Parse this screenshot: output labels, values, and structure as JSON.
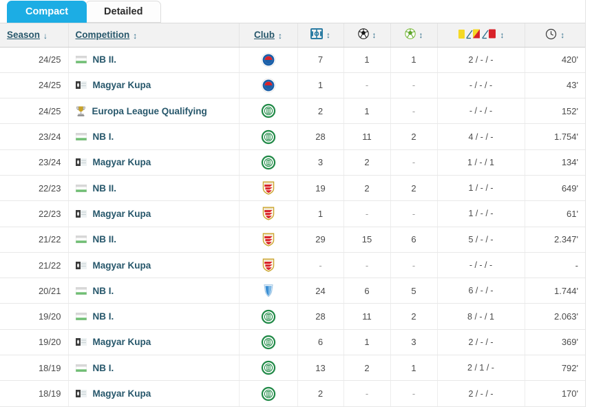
{
  "tabs": [
    {
      "label": "Compact",
      "active": true,
      "name": "tab-compact"
    },
    {
      "label": "Detailed",
      "active": false,
      "name": "tab-detailed"
    }
  ],
  "colors": {
    "tab_active_bg": "#1cade4",
    "header_bg": "#f2f2f2",
    "link": "#27576b",
    "number": "#2b7ca3",
    "yellow_card": "#f5d926",
    "red_card": "#d8232a"
  },
  "table": {
    "columns": [
      {
        "key": "season",
        "label": "Season",
        "icon": "",
        "sort": "desc",
        "sortable": true
      },
      {
        "key": "competition",
        "label": "Competition",
        "icon": "",
        "sort": "sortable",
        "sortable": true
      },
      {
        "key": "club",
        "label": "Club",
        "icon": "",
        "sort": "sortable",
        "sortable": true
      },
      {
        "key": "appearances",
        "label": "",
        "icon": "pitch-icon",
        "sort": "sortable",
        "sortable": true
      },
      {
        "key": "goals",
        "label": "",
        "icon": "football-icon",
        "sort": "sortable",
        "sortable": true
      },
      {
        "key": "assists",
        "label": "",
        "icon": "assist-ball-icon",
        "sort": "sortable",
        "sortable": true
      },
      {
        "key": "cards",
        "label": "",
        "icon": "cards-icon",
        "sort": "sortable",
        "sortable": true
      },
      {
        "key": "minutes",
        "label": "",
        "icon": "clock-icon",
        "sort": "sortable",
        "sortable": true
      }
    ],
    "rows": [
      {
        "season": "24/25",
        "competition": "NB II.",
        "comp_icon": "hungary-flag-icon",
        "club_badge": "club-blue-red-circle",
        "appearances": "7",
        "goals": "1",
        "assists": "1",
        "cards": "2 / - / -",
        "minutes": "420'"
      },
      {
        "season": "24/25",
        "competition": "Magyar Kupa",
        "comp_icon": "cup-flag-icon",
        "club_badge": "club-blue-red-circle",
        "appearances": "1",
        "goals": "-",
        "assists": "-",
        "cards": "- / - / -",
        "minutes": "43'"
      },
      {
        "season": "24/25",
        "competition": "Europa League Qualifying",
        "comp_icon": "trophy-icon",
        "club_badge": "club-green-circle",
        "appearances": "2",
        "goals": "1",
        "assists": "-",
        "cards": "- / - / -",
        "minutes": "152'"
      },
      {
        "season": "23/24",
        "competition": "NB I.",
        "comp_icon": "hungary-flag-icon",
        "club_badge": "club-green-circle",
        "appearances": "28",
        "goals": "11",
        "assists": "2",
        "cards": "4 / - / -",
        "minutes": "1.754'"
      },
      {
        "season": "23/24",
        "competition": "Magyar Kupa",
        "comp_icon": "cup-flag-icon",
        "club_badge": "club-green-circle",
        "appearances": "3",
        "goals": "2",
        "assists": "-",
        "cards": "1 / - / 1",
        "minutes": "134'"
      },
      {
        "season": "22/23",
        "competition": "NB II.",
        "comp_icon": "hungary-flag-icon",
        "club_badge": "club-red-white-shield",
        "appearances": "19",
        "goals": "2",
        "assists": "2",
        "cards": "1 / - / -",
        "minutes": "649'"
      },
      {
        "season": "22/23",
        "competition": "Magyar Kupa",
        "comp_icon": "cup-flag-icon",
        "club_badge": "club-red-white-shield",
        "appearances": "1",
        "goals": "-",
        "assists": "-",
        "cards": "1 / - / -",
        "minutes": "61'"
      },
      {
        "season": "21/22",
        "competition": "NB II.",
        "comp_icon": "hungary-flag-icon",
        "club_badge": "club-red-white-shield",
        "appearances": "29",
        "goals": "15",
        "assists": "6",
        "cards": "5 / - / -",
        "minutes": "2.347'"
      },
      {
        "season": "21/22",
        "competition": "Magyar Kupa",
        "comp_icon": "cup-flag-icon",
        "club_badge": "club-red-white-shield",
        "appearances": "-",
        "goals": "-",
        "assists": "-",
        "cards": "- / - / -",
        "minutes": "-"
      },
      {
        "season": "20/21",
        "competition": "NB I.",
        "comp_icon": "hungary-flag-icon",
        "club_badge": "club-blue-shield",
        "appearances": "24",
        "goals": "6",
        "assists": "5",
        "cards": "6 / - / -",
        "minutes": "1.744'"
      },
      {
        "season": "19/20",
        "competition": "NB I.",
        "comp_icon": "hungary-flag-icon",
        "club_badge": "club-green-circle",
        "appearances": "28",
        "goals": "11",
        "assists": "2",
        "cards": "8 / - / 1",
        "minutes": "2.063'"
      },
      {
        "season": "19/20",
        "competition": "Magyar Kupa",
        "comp_icon": "cup-flag-icon",
        "club_badge": "club-green-circle",
        "appearances": "6",
        "goals": "1",
        "assists": "3",
        "cards": "2 / - / -",
        "minutes": "369'"
      },
      {
        "season": "18/19",
        "competition": "NB I.",
        "comp_icon": "hungary-flag-icon",
        "club_badge": "club-green-circle",
        "appearances": "13",
        "goals": "2",
        "assists": "1",
        "cards": "2 / 1 / -",
        "minutes": "792'"
      },
      {
        "season": "18/19",
        "competition": "Magyar Kupa",
        "comp_icon": "cup-flag-icon",
        "club_badge": "club-green-circle",
        "appearances": "2",
        "goals": "-",
        "assists": "-",
        "cards": "2 / - / -",
        "minutes": "170'"
      }
    ]
  }
}
